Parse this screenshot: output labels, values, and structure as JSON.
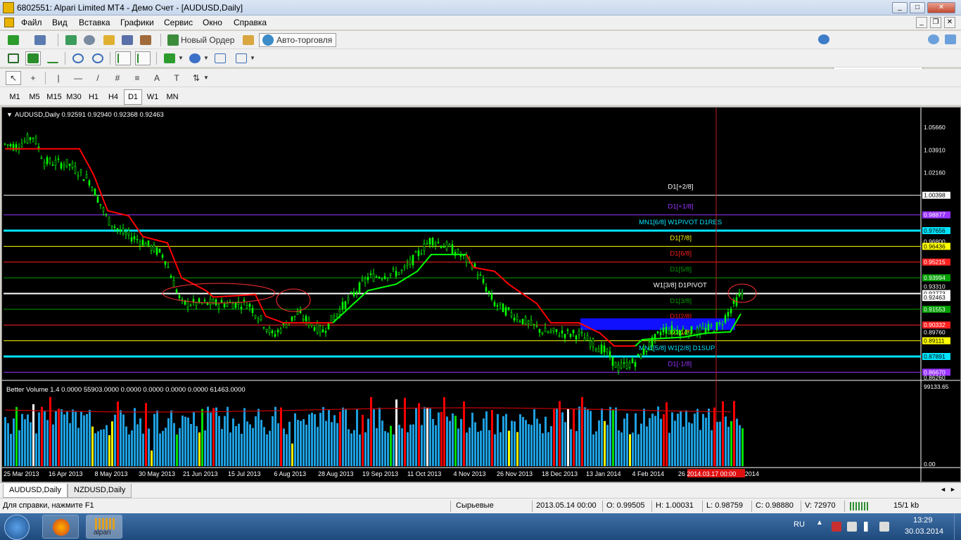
{
  "window": {
    "title": "6802551: Alpari Limited MT4 - Демо Счет - [AUDUSD,Daily]",
    "controls": [
      "_",
      "□",
      "✕"
    ]
  },
  "menu": [
    "Файл",
    "Вид",
    "Вставка",
    "Графики",
    "Сервис",
    "Окно",
    "Справка"
  ],
  "toolbar": {
    "new_order": "Новый Ордер",
    "auto_trading": "Авто-торговля"
  },
  "search": {
    "value": ""
  },
  "timeframes": [
    "M1",
    "M5",
    "M15",
    "M30",
    "H1",
    "H4",
    "D1",
    "W1",
    "MN"
  ],
  "active_timeframe": "D1",
  "chart": {
    "header": "AUDUSD,Daily  0.92591 0.92940 0.92368 0.92463",
    "indicator_header": "Better Volume 1.4 0.0000 55903.0000 0.0000 0.0000 0.0000 0.0000 61463.0000",
    "price_ticks": [
      "1.05660",
      "1.03910",
      "1.02160",
      "1.00398",
      "0.98877",
      "0.97656",
      "0.96800",
      "0.96436",
      "0.95215",
      "0.93994",
      "0.93310",
      "0.92773",
      "0.92463",
      "0.91553",
      "0.90332",
      "0.89760",
      "0.89111",
      "0.87891",
      "0.86670",
      "0.86260"
    ],
    "volume_ticks": [
      "99133.65",
      "0.00"
    ],
    "date_labels": [
      "25 Mar 2013",
      "16 Apr 2013",
      "8 May 2013",
      "30 May 2013",
      "21 Jun 2013",
      "15 Jul 2013",
      "6 Aug 2013",
      "28 Aug 2013",
      "19 Sep 2013",
      "11 Oct 2013",
      "4 Nov 2013",
      "26 Nov 2013",
      "18 Dec 2013",
      "13 Jan 2014",
      "4 Feb 2014",
      "26",
      "2014.03.17 00:00",
      "2014"
    ],
    "murrey_labels": [
      {
        "text": "D1[+2/8]",
        "color": "#ffffff"
      },
      {
        "text": "D1[+1/8]",
        "color": "#9933ff"
      },
      {
        "text": "MN1[6/8] W1PIVOT D1RES",
        "color": "#00e5ff"
      },
      {
        "text": "D1[7/8]",
        "color": "#ffff00"
      },
      {
        "text": "D1[6/8]",
        "color": "#ff2020"
      },
      {
        "text": "D1[5/8]",
        "color": "#00a000"
      },
      {
        "text": "W1[3/8] D1PIVOT",
        "color": "#ffffff"
      },
      {
        "text": "D1[3/8]",
        "color": "#00a000"
      },
      {
        "text": "D1[2/8]",
        "color": "#ff2020"
      },
      {
        "text": "D1[1/8]",
        "color": "#ffff00"
      },
      {
        "text": "MN1[5/8] W1[2/8] D1SUP",
        "color": "#00e5ff"
      },
      {
        "text": "D1[-1/8]",
        "color": "#9933ff"
      }
    ],
    "colors": {
      "bull": "#00ff00",
      "bear": "#00ff00",
      "trail_red": "#ff0000",
      "trail_green": "#00ff00",
      "vol_blue": "#1e9fe0",
      "vol_red": "#ff0000",
      "vol_yellow": "#ffff00",
      "vol_green": "#00e000",
      "vol_white": "#ffffff"
    }
  },
  "symbol_tabs": [
    "AUDUSD,Daily",
    "NZDUSD,Daily"
  ],
  "status": {
    "help": "Для справки, нажмите F1",
    "profile": "Сырьевые",
    "time": "2013.05.14 00:00",
    "open": "O: 0.99505",
    "high": "H: 1.00031",
    "low": "L: 0.98759",
    "close": "C: 0.98880",
    "volume": "V: 72970",
    "traffic": "15/1 kb"
  },
  "taskbar": {
    "lang": "RU",
    "time": "13:29",
    "date": "30.03.2014",
    "app_label": "alpari"
  }
}
